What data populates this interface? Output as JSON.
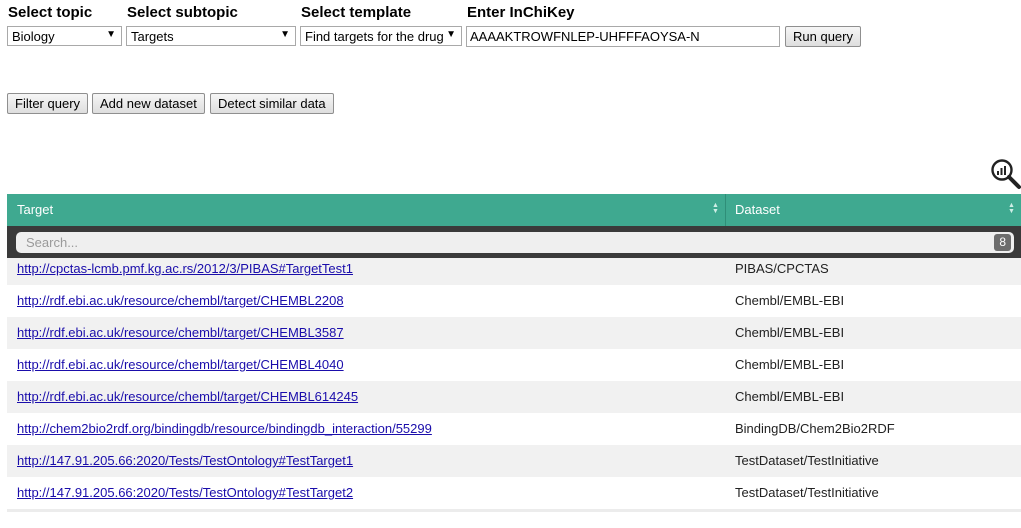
{
  "query": {
    "topic_label": "Select topic",
    "topic_value": "Biology",
    "subtopic_label": "Select subtopic",
    "subtopic_value": "Targets",
    "template_label": "Select template",
    "template_value": "Find targets for the drug",
    "inchikey_label": "Enter InChiKey",
    "inchikey_value": "AAAAKTROWFNLEP-UHFFFAOYSA-N",
    "run_label": "Run query",
    "dropdown_arrow": "▼"
  },
  "actions": {
    "filter_label": "Filter query",
    "add_dataset_label": "Add new dataset",
    "detect_similar_label": "Detect similar data"
  },
  "table": {
    "col_target": "Target",
    "col_dataset": "Dataset",
    "search_placeholder": "Search...",
    "count": "8",
    "header_color": "#3fa990",
    "rows": [
      {
        "target": "http://cpctas-lcmb.pmf.kg.ac.rs/2012/3/PIBAS#TargetTest1",
        "dataset": "PIBAS/CPCTAS"
      },
      {
        "target": "http://rdf.ebi.ac.uk/resource/chembl/target/CHEMBL2208",
        "dataset": "Chembl/EMBL-EBI"
      },
      {
        "target": "http://rdf.ebi.ac.uk/resource/chembl/target/CHEMBL3587",
        "dataset": "Chembl/EMBL-EBI"
      },
      {
        "target": "http://rdf.ebi.ac.uk/resource/chembl/target/CHEMBL4040",
        "dataset": "Chembl/EMBL-EBI"
      },
      {
        "target": "http://rdf.ebi.ac.uk/resource/chembl/target/CHEMBL614245",
        "dataset": "Chembl/EMBL-EBI"
      },
      {
        "target": "http://chem2bio2rdf.org/bindingdb/resource/bindingdb_interaction/55299",
        "dataset": "BindingDB/Chem2Bio2RDF"
      },
      {
        "target": "http://147.91.205.66:2020/Tests/TestOntology#TestTarget1",
        "dataset": "TestDataset/TestInitiative"
      },
      {
        "target": "http://147.91.205.66:2020/Tests/TestOntology#TestTarget2",
        "dataset": "TestDataset/TestInitiative"
      }
    ]
  },
  "icons": {
    "zoom_chart": "magnifier-chart-icon"
  }
}
